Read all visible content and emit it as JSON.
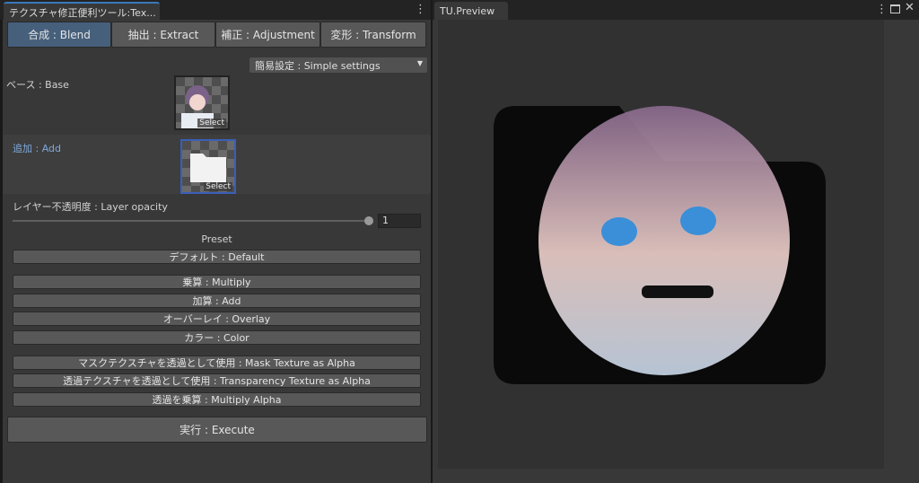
{
  "left_window": {
    "tab_title": "テクスチャ修正便利ツール:Tex...",
    "menu_icon": "kebab-icon",
    "tabs": [
      {
        "label": "合成 : Blend",
        "active": true
      },
      {
        "label": "抽出 : Extract"
      },
      {
        "label": "補正 : Adjustment"
      },
      {
        "label": "変形 : Transform"
      }
    ],
    "mode_dropdown": "簡易設定 : Simple settings",
    "base_label": "ベース : Base",
    "add_label": "追加 : Add",
    "select_label": "Select",
    "opacity_label": "レイヤー不透明度 : Layer opacity",
    "opacity_value": "1",
    "opacity_fraction": 1.0,
    "preset_label": "Preset",
    "presets": [
      "デフォルト : Default",
      "乗算 : Multiply",
      "加算 : Add",
      "オーバーレイ : Overlay",
      "カラー : Color",
      "マスクテクスチャを透過として使用 : Mask Texture as Alpha",
      "透過テクスチャを透過として使用 : Transparency Texture as Alpha",
      "透過を乗算 : Multiply Alpha"
    ],
    "execute_label": "実行 : Execute"
  },
  "right_window": {
    "tab_title": "TU.Preview",
    "colors": {
      "accent": "#3a79bb"
    }
  }
}
